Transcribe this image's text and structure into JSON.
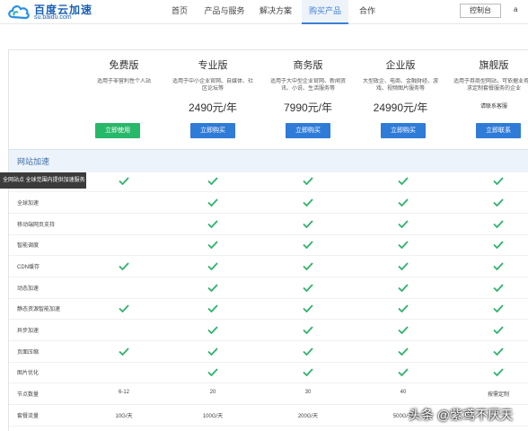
{
  "logo": {
    "title": "百度云加速",
    "subtitle": "su.baidu.com"
  },
  "nav": [
    {
      "label": "首页",
      "active": false
    },
    {
      "label": "产品与服务",
      "active": false
    },
    {
      "label": "解决方案",
      "active": false
    },
    {
      "label": "购买产品",
      "active": true
    },
    {
      "label": "合作",
      "active": false
    }
  ],
  "header_right": {
    "console": "控制台",
    "user": "a"
  },
  "plans": [
    {
      "name": "免费版",
      "desc": "适用于非营利性个人站",
      "price": "",
      "button": "立即使用",
      "button_style": "green"
    },
    {
      "name": "专业版",
      "desc": "适用于中小企业官网、自媒体、社区论坛等",
      "price": "2490元/年",
      "button": "立即购买",
      "button_style": "blue"
    },
    {
      "name": "商务版",
      "desc": "适用于大中型企业官网、新闻资讯、小说、生活服务等",
      "price": "7990元/年",
      "button": "立即购买",
      "button_style": "blue"
    },
    {
      "name": "企业版",
      "desc": "大型政企、电商、金融财经、游戏、视频图片服务等",
      "price": "24990元/年",
      "button": "立即购买",
      "button_style": "blue"
    },
    {
      "name": "旗舰版",
      "desc": "适用于券商型网站，可依据业务需求定制套餐服务的企业",
      "price": "请联系客服",
      "button": "立即联系",
      "button_style": "blue"
    }
  ],
  "section": {
    "title": "网站加速"
  },
  "tooltip": "全网站点 全球范围内提供加速服务",
  "rows": [
    {
      "label": "",
      "cells": [
        true,
        true,
        true,
        true,
        true
      ]
    },
    {
      "label": "全球加速",
      "cells": [
        false,
        true,
        true,
        true,
        true
      ]
    },
    {
      "label": "移动端网页支持",
      "cells": [
        false,
        true,
        true,
        true,
        true
      ]
    },
    {
      "label": "智能调度",
      "cells": [
        false,
        true,
        true,
        true,
        true
      ]
    },
    {
      "label": "CDN缓存",
      "cells": [
        true,
        true,
        true,
        true,
        true
      ]
    },
    {
      "label": "动态加速",
      "cells": [
        false,
        true,
        true,
        true,
        true
      ]
    },
    {
      "label": "静态资源智能加速",
      "cells": [
        true,
        true,
        true,
        true,
        true
      ]
    },
    {
      "label": "异步加速",
      "cells": [
        false,
        true,
        true,
        true,
        true
      ]
    },
    {
      "label": "页面压缩",
      "cells": [
        true,
        true,
        true,
        true,
        true
      ]
    },
    {
      "label": "图片优化",
      "cells": [
        false,
        true,
        true,
        true,
        true
      ]
    },
    {
      "label": "节点数量",
      "cells": [
        "6-12",
        "20",
        "30",
        "40",
        "按需定制"
      ]
    },
    {
      "label": "套餐流量",
      "cells": [
        "10G/天",
        "100G/天",
        "200G/天",
        "500G/天",
        ""
      ]
    }
  ],
  "watermark": "头条 @紫鸢不厌天",
  "colors": {
    "accent": "#2f7bd8",
    "green_button": "#28b86a",
    "check": "#2fb36c",
    "section_bg": "#edf3fb"
  }
}
